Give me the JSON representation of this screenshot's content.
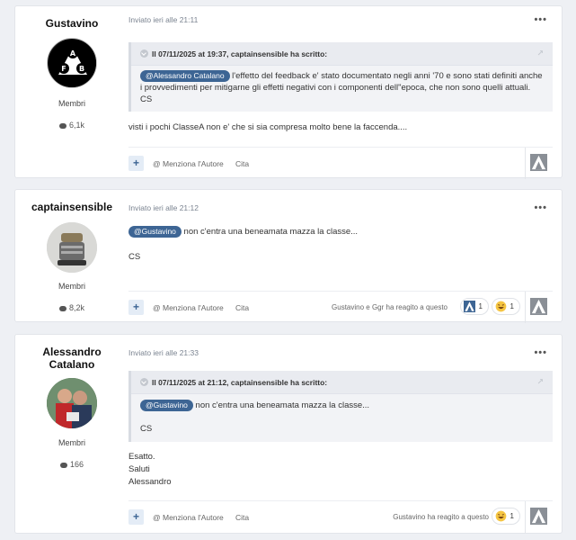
{
  "posts": [
    {
      "author": "Gustavino",
      "role": "Membri",
      "count": "6,1k",
      "meta": "Inviato ieri alle 21:11",
      "quote_header": "Il 07/11/2025 at 19:37, captainsensible ha scritto:",
      "quote_mention": "@Alessandro Catalano",
      "quote_text": " l'effetto del feedback e' stato documentato negli anni '70 e sono stati definiti anche i provvedimenti per mitigarne gli effetti negativi con i componenti dell\"epoca, che non sono quelli attuali.",
      "quote_sign": "CS",
      "text": "visti i pochi ClasseA  non e' che si sia compresa molto bene la faccenda....",
      "mention_author": "@ Menziona l'Autore",
      "cite": "Cita"
    },
    {
      "author": "captainsensible",
      "role": "Membri",
      "count": "8,2k",
      "meta": "Inviato ieri alle 21:12",
      "mention": "@Gustavino",
      "text": " non c'entra una beneamata mazza la classe...",
      "sign": "CS",
      "mention_author": "@ Menziona l'Autore",
      "cite": "Cita",
      "reacted": "Gustavino e Ggr ha reagito a questo",
      "reactions": [
        {
          "icon": "thanks-icon",
          "count": "1"
        },
        {
          "icon": "haha-icon",
          "count": "1"
        }
      ]
    },
    {
      "author": "Alessandro Catalano",
      "role": "Membri",
      "count": "166",
      "meta": "Inviato ieri alle 21:33",
      "quote_header": "Il 07/11/2025 at 21:12, captainsensible ha scritto:",
      "quote_mention": "@Gustavino",
      "quote_text": " non c'entra una beneamata mazza la classe...",
      "quote_sign": "CS",
      "lines": [
        "Esatto.",
        "Saluti",
        "Alessandro"
      ],
      "mention_author": "@ Menziona l'Autore",
      "cite": "Cita",
      "reacted": "Gustavino ha reagito a questo",
      "reactions": [
        {
          "icon": "haha-icon",
          "count": "1"
        }
      ]
    }
  ],
  "colors": {
    "accent": "#3d6594",
    "background": "#eef0f4"
  }
}
